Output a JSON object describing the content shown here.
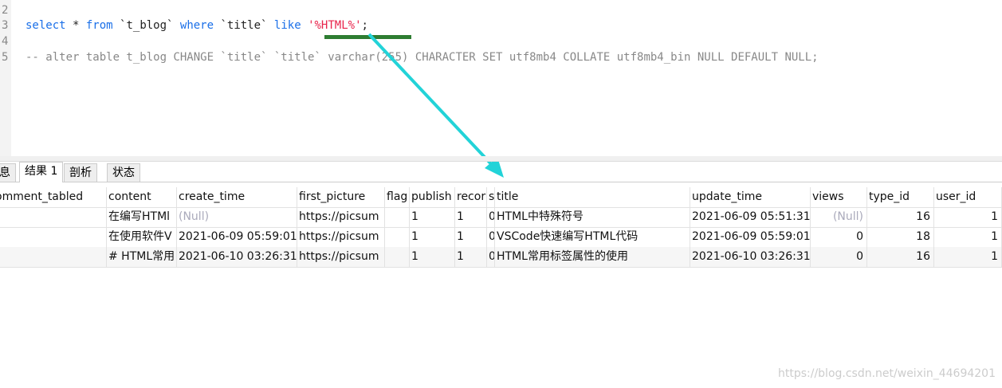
{
  "editor": {
    "lines": [
      {
        "no": "2",
        "text": ""
      },
      {
        "no": "3",
        "parts": [
          [
            "kw",
            "select"
          ],
          [
            "",
            "* "
          ],
          [
            "kw",
            "from"
          ],
          [
            "",
            "`t_blog` "
          ],
          [
            "kw",
            "where"
          ],
          [
            "",
            "`title` "
          ],
          [
            "kw",
            "like"
          ],
          [
            "str",
            "'%HTML%'"
          ],
          [
            "",
            ";"
          ]
        ]
      },
      {
        "no": "4",
        "text": ""
      },
      {
        "no": "5",
        "comment": "-- alter table t_blog CHANGE `title` `title` varchar(255) CHARACTER SET utf8mb4 COLLATE utf8mb4_bin NULL DEFAULT NULL;"
      }
    ]
  },
  "tabs": [
    {
      "label": "息"
    },
    {
      "label": "结果 1",
      "active": true
    },
    {
      "label": "剖析"
    },
    {
      "label": "状态"
    }
  ],
  "columns": [
    "omment_tabled",
    "content",
    "create_time",
    "first_picture",
    "flag",
    "publish",
    "recor",
    "s",
    "title",
    "update_time",
    "views",
    "type_id",
    "user_id"
  ],
  "rows": [
    [
      "",
      "在编写HTMl",
      "(Null)",
      "https://picsum",
      "",
      "1",
      "1",
      "0",
      "HTML中特殊符号",
      "2021-06-09 05:51:31",
      "(Null)",
      "16",
      "1"
    ],
    [
      "",
      "在使用软件V",
      "2021-06-09 05:59:01",
      "https://picsum",
      "",
      "1",
      "1",
      "0",
      "VSCode快速编写HTML代码",
      "2021-06-09 05:59:01",
      "0",
      "18",
      "1"
    ],
    [
      "",
      "# HTML常用",
      "2021-06-10 03:26:31",
      "https://picsum",
      "",
      "1",
      "1",
      "0",
      "HTML常用标签属性的使用",
      "2021-06-10 03:26:31",
      "0",
      "16",
      "1"
    ]
  ],
  "watermark": "https://blog.csdn.net/weixin_44694201",
  "colors": {
    "highlight": "#2e7d32",
    "arrow": "#22d3d8",
    "keyword": "#1a6fe8",
    "string": "#e8234a"
  }
}
